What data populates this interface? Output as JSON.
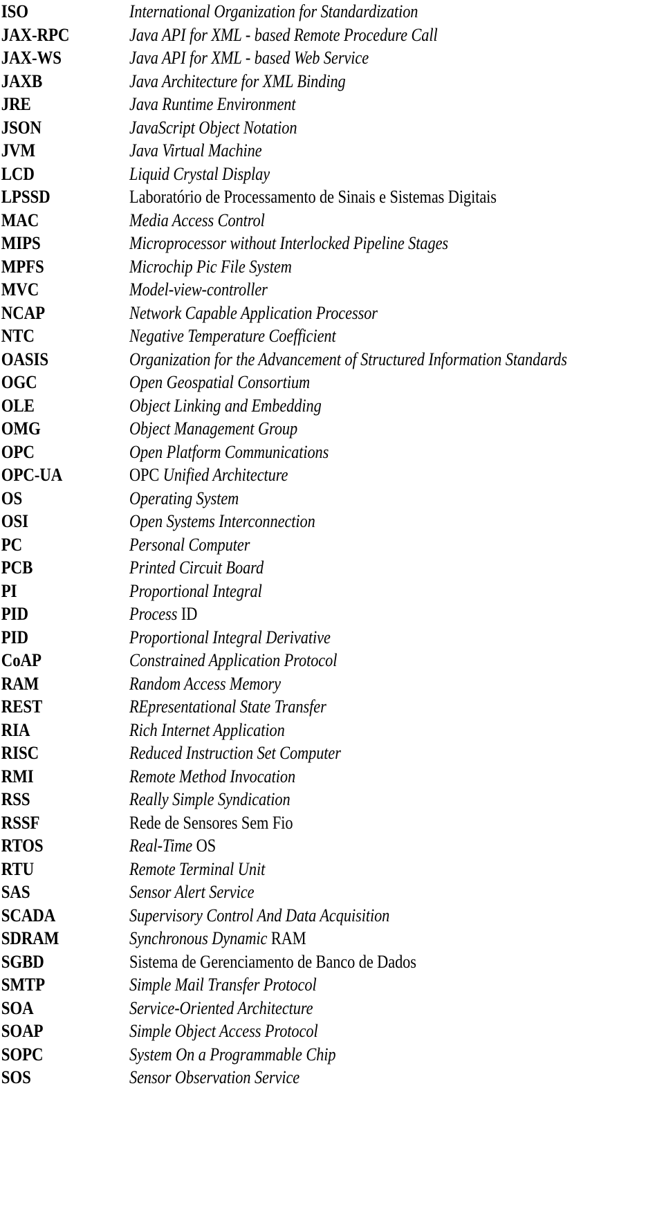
{
  "page": {
    "kind": "list-of-abbreviations",
    "column_headers_visible": false,
    "row_count": 47
  },
  "entries": [
    {
      "term": "ISO",
      "definition": "International Organization for Standardization",
      "style": "italic"
    },
    {
      "term": "JAX-RPC",
      "definition": "Java API for XML - based Remote Procedure Call",
      "style": "italic"
    },
    {
      "term": "JAX-WS",
      "definition": "Java API for XML - based Web Service",
      "style": "italic"
    },
    {
      "term": "JAXB",
      "definition": "Java Architecture for XML Binding",
      "style": "italic"
    },
    {
      "term": "JRE",
      "definition": "Java Runtime Environment",
      "style": "italic"
    },
    {
      "term": "JSON",
      "definition": "JavaScript Object Notation",
      "style": "italic"
    },
    {
      "term": "JVM",
      "definition": "Java Virtual Machine",
      "style": "italic"
    },
    {
      "term": "LCD",
      "definition": "Liquid Crystal Display",
      "style": "italic"
    },
    {
      "term": "LPSSD",
      "definition": "Laboratório de Processamento de Sinais e Sistemas Digitais",
      "style": "upright"
    },
    {
      "term": "MAC",
      "definition": "Media Access Control",
      "style": "italic"
    },
    {
      "term": "MIPS",
      "definition": "Microprocessor without Interlocked Pipeline Stages",
      "style": "italic"
    },
    {
      "term": "MPFS",
      "definition": "Microchip Pic File System",
      "style": "italic"
    },
    {
      "term": "MVC",
      "definition": "Model-view-controller",
      "style": "italic"
    },
    {
      "term": "NCAP",
      "definition": "Network Capable Application Processor",
      "style": "italic"
    },
    {
      "term": "NTC",
      "definition": "Negative Temperature Coefficient",
      "style": "italic"
    },
    {
      "term": "OASIS",
      "definition": "Organization for the Advancement of Structured Information Standards",
      "style": "italic"
    },
    {
      "term": "OGC",
      "definition": "Open Geospatial Consortium",
      "style": "italic"
    },
    {
      "term": "OLE",
      "definition": "Object Linking and Embedding",
      "style": "italic"
    },
    {
      "term": "OMG",
      "definition": "Object Management Group",
      "style": "italic"
    },
    {
      "term": "OPC",
      "definition": "Open Platform Communications",
      "style": "italic"
    },
    {
      "term": "OPC-UA",
      "definition": "OPC Unified Architecture",
      "style": "mixed",
      "lead_roman": "OPC ",
      "trail_italic": "Unified Architecture"
    },
    {
      "term": "OS",
      "definition": "Operating System",
      "style": "italic"
    },
    {
      "term": "OSI",
      "definition": "Open Systems Interconnection",
      "style": "italic"
    },
    {
      "term": "PC",
      "definition": "Personal Computer",
      "style": "italic"
    },
    {
      "term": "PCB",
      "definition": "Printed Circuit Board",
      "style": "italic"
    },
    {
      "term": "PI",
      "definition": "Proportional Integral",
      "style": "italic"
    },
    {
      "term": "PID",
      "definition": "Process ID",
      "style": "mixed2",
      "lead_italic": "Process ",
      "trail_roman": "ID"
    },
    {
      "term": "PID",
      "definition": "Proportional Integral Derivative",
      "style": "italic"
    },
    {
      "term": "CoAP",
      "definition": "Constrained Application Protocol",
      "style": "italic"
    },
    {
      "term": "RAM",
      "definition": "Random Access Memory",
      "style": "italic"
    },
    {
      "term": "REST",
      "definition": "REpresentational State Transfer",
      "style": "italic"
    },
    {
      "term": "RIA",
      "definition": "Rich Internet Application",
      "style": "italic"
    },
    {
      "term": "RISC",
      "definition": "Reduced Instruction Set Computer",
      "style": "italic"
    },
    {
      "term": "RMI",
      "definition": "Remote Method Invocation",
      "style": "italic"
    },
    {
      "term": "RSS",
      "definition": "Really Simple Syndication",
      "style": "italic"
    },
    {
      "term": "RSSF",
      "definition": "Rede de Sensores Sem Fio",
      "style": "upright"
    },
    {
      "term": "RTOS",
      "definition": "Real-Time OS",
      "style": "mixed2",
      "lead_italic": "Real-Time ",
      "trail_roman": "OS"
    },
    {
      "term": "RTU",
      "definition": "Remote Terminal Unit",
      "style": "italic"
    },
    {
      "term": "SAS",
      "definition": "Sensor Alert Service",
      "style": "italic"
    },
    {
      "term": "SCADA",
      "definition": "Supervisory Control And Data Acquisition",
      "style": "italic"
    },
    {
      "term": "SDRAM",
      "definition": "Synchronous Dynamic RAM",
      "style": "mixed2",
      "lead_italic": "Synchronous Dynamic ",
      "trail_roman": "RAM"
    },
    {
      "term": "SGBD",
      "definition": "Sistema de Gerenciamento de Banco de Dados",
      "style": "upright"
    },
    {
      "term": "SMTP",
      "definition": "Simple Mail Transfer Protocol",
      "style": "italic"
    },
    {
      "term": "SOA",
      "definition": "Service-Oriented Architecture",
      "style": "italic"
    },
    {
      "term": "SOAP",
      "definition": "Simple Object Access Protocol",
      "style": "italic"
    },
    {
      "term": "SOPC",
      "definition": "System On a Programmable Chip",
      "style": "italic"
    },
    {
      "term": "SOS",
      "definition": "Sensor Observation Service",
      "style": "italic"
    }
  ],
  "colors": {
    "text": "#000000",
    "background": "#ffffff"
  }
}
